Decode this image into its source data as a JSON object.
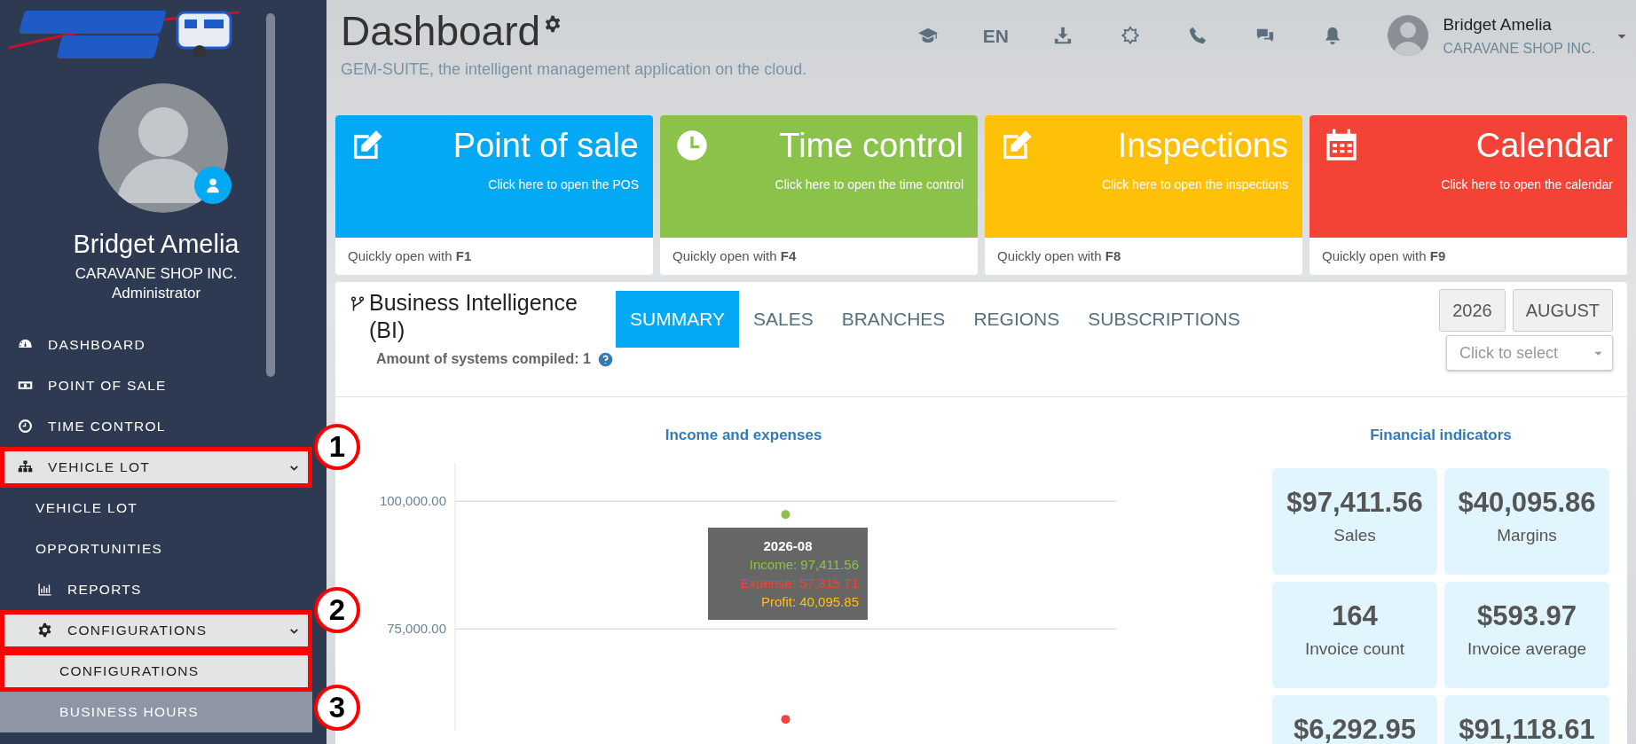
{
  "sidebar": {
    "user": {
      "name": "Bridget Amelia",
      "company": "CARAVANE SHOP INC.",
      "role": "Administrator"
    },
    "menu": [
      {
        "label": "DASHBOARD",
        "selected": false,
        "hovered": false
      },
      {
        "label": "POINT OF SALE",
        "selected": false,
        "hovered": false
      },
      {
        "label": "TIME CONTROL",
        "selected": false,
        "hovered": false
      },
      {
        "label": "VEHICLE LOT",
        "selected": true,
        "hovered": false,
        "expanded": true,
        "callout": {
          "number": "1",
          "boxed": true
        },
        "children": [
          {
            "label": "VEHICLE LOT",
            "selected": false,
            "hovered": false
          },
          {
            "label": "OPPORTUNITIES",
            "selected": false,
            "hovered": false
          },
          {
            "label": "REPORTS",
            "selected": false,
            "hovered": false
          },
          {
            "label": "CONFIGURATIONS",
            "selected": true,
            "hovered": false,
            "expanded": true,
            "callout": {
              "number": "2",
              "boxed": true
            },
            "children": [
              {
                "label": "CONFIGURATIONS",
                "selected": true,
                "hovered": false,
                "callout": {
                  "boxed": true
                }
              },
              {
                "label": "BUSINESS HOURS",
                "selected": false,
                "hovered": true,
                "callout": {
                  "number": "3",
                  "boxed": false
                }
              }
            ]
          }
        ]
      }
    ]
  },
  "header": {
    "title": "Dashboard",
    "subtitle": "GEM-SUITE, the intelligent management application on the cloud.",
    "language": "EN",
    "user": {
      "name": "Bridget Amelia",
      "company": "CARAVANE SHOP INC."
    }
  },
  "tiles": [
    {
      "title": "Point of sale",
      "subtitle": "Click here to open the POS",
      "footer": "Quickly open with **F1**",
      "color": "#03a9f4"
    },
    {
      "title": "Time control",
      "subtitle": "Click here to open the time control",
      "footer": "Quickly open with **F4**",
      "color": "#8bc34a"
    },
    {
      "title": "Inspections",
      "subtitle": "Click here to open the inspections",
      "footer": "Quickly open with **F8**",
      "color": "#ffc107"
    },
    {
      "title": "Calendar",
      "subtitle": "Click here to open the calendar",
      "footer": "Quickly open with **F9**",
      "color": "#f44336"
    }
  ],
  "bi": {
    "title": "Business Intelligence (BI)",
    "compiled": "Amount of systems compiled: 1",
    "tabs": [
      {
        "label": "SUMMARY",
        "selected": true
      },
      {
        "label": "SALES",
        "selected": false
      },
      {
        "label": "BRANCHES",
        "selected": false
      },
      {
        "label": "REGIONS",
        "selected": false
      },
      {
        "label": "SUBSCRIPTIONS",
        "selected": false
      }
    ],
    "year": "2026",
    "month": "AUGUST",
    "select": {
      "placeholder": "Click to select"
    },
    "chart": {
      "chart_data": {
        "type": "scatter",
        "title": "Income and expenses",
        "ylim": [
          55000,
          107500
        ],
        "yticks": [
          {
            "value": 75000,
            "label": "75,000.00"
          },
          {
            "value": 100000,
            "label": "100,000.00"
          }
        ],
        "series": [
          {
            "color": "#8bc34a",
            "values": [
              97400
            ]
          },
          {
            "color": "#f44336",
            "values": [
              57300
            ]
          }
        ]
      },
      "tooltip": {
        "title": "2026-08",
        "lines": [
          {
            "text": "Income: 97,411.56",
            "color": "#8bc34a"
          },
          {
            "text": "Expense: 57,315.71",
            "color": "#f44336"
          },
          {
            "text": "Profit: 40,095.85",
            "color": "#ffc107"
          }
        ]
      }
    },
    "indicators": {
      "title": "Financial indicators",
      "items": [
        {
          "value": "$97,411.56",
          "label": "Sales"
        },
        {
          "value": "$40,095.86",
          "label": "Margins"
        },
        {
          "value": "164",
          "label": "Invoice count"
        },
        {
          "value": "$593.97",
          "label": "Invoice average"
        },
        {
          "value": "$6,292.95"
        },
        {
          "value": "$91,118.61"
        }
      ]
    }
  }
}
